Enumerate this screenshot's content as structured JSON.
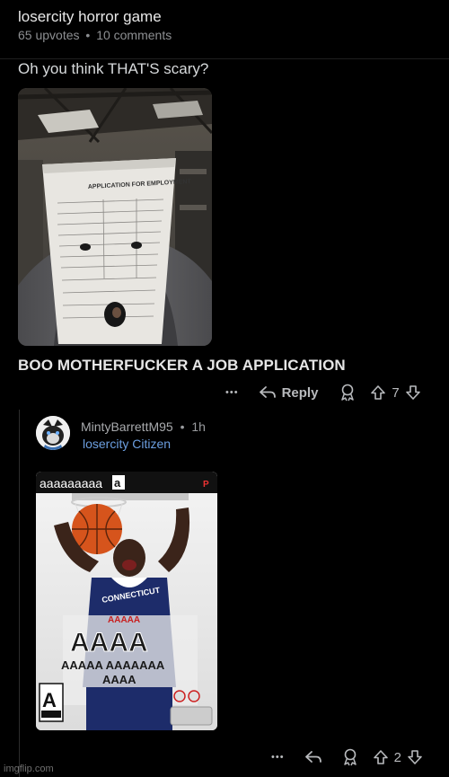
{
  "post": {
    "title": "losercity horror game",
    "upvotes": "65 upvotes",
    "separator": "•",
    "comments": "10 comments"
  },
  "comment1": {
    "text_top": "Oh you think THAT'S scary?",
    "image_text": {
      "line1": "APPLICATION FOR EMPLOYMENT"
    },
    "text_bottom": "BOO MOTHERFUCKER A JOB APPLICATION",
    "actions": {
      "more": "•••",
      "reply_label": "Reply",
      "score": "7"
    }
  },
  "comment2": {
    "username": "MintyBarrettM95",
    "separator": "•",
    "time": "1h",
    "flair": "losercity Citizen",
    "cover_text": {
      "header": "aaaaaaaaa",
      "badge": "a",
      "logo_line1": "AAAAA",
      "logo_big": "AAAA",
      "logo_line2": "AAAAA AAAAAAA",
      "logo_line3": "AAAA",
      "rating": "A",
      "jersey": "CONNECTICUT"
    },
    "actions": {
      "more": "•••",
      "score": "2"
    }
  },
  "watermark": "imgflip.com",
  "colors": {
    "background": "#000000",
    "flair": "#6c9fe0",
    "meta": "#8d8f92"
  }
}
